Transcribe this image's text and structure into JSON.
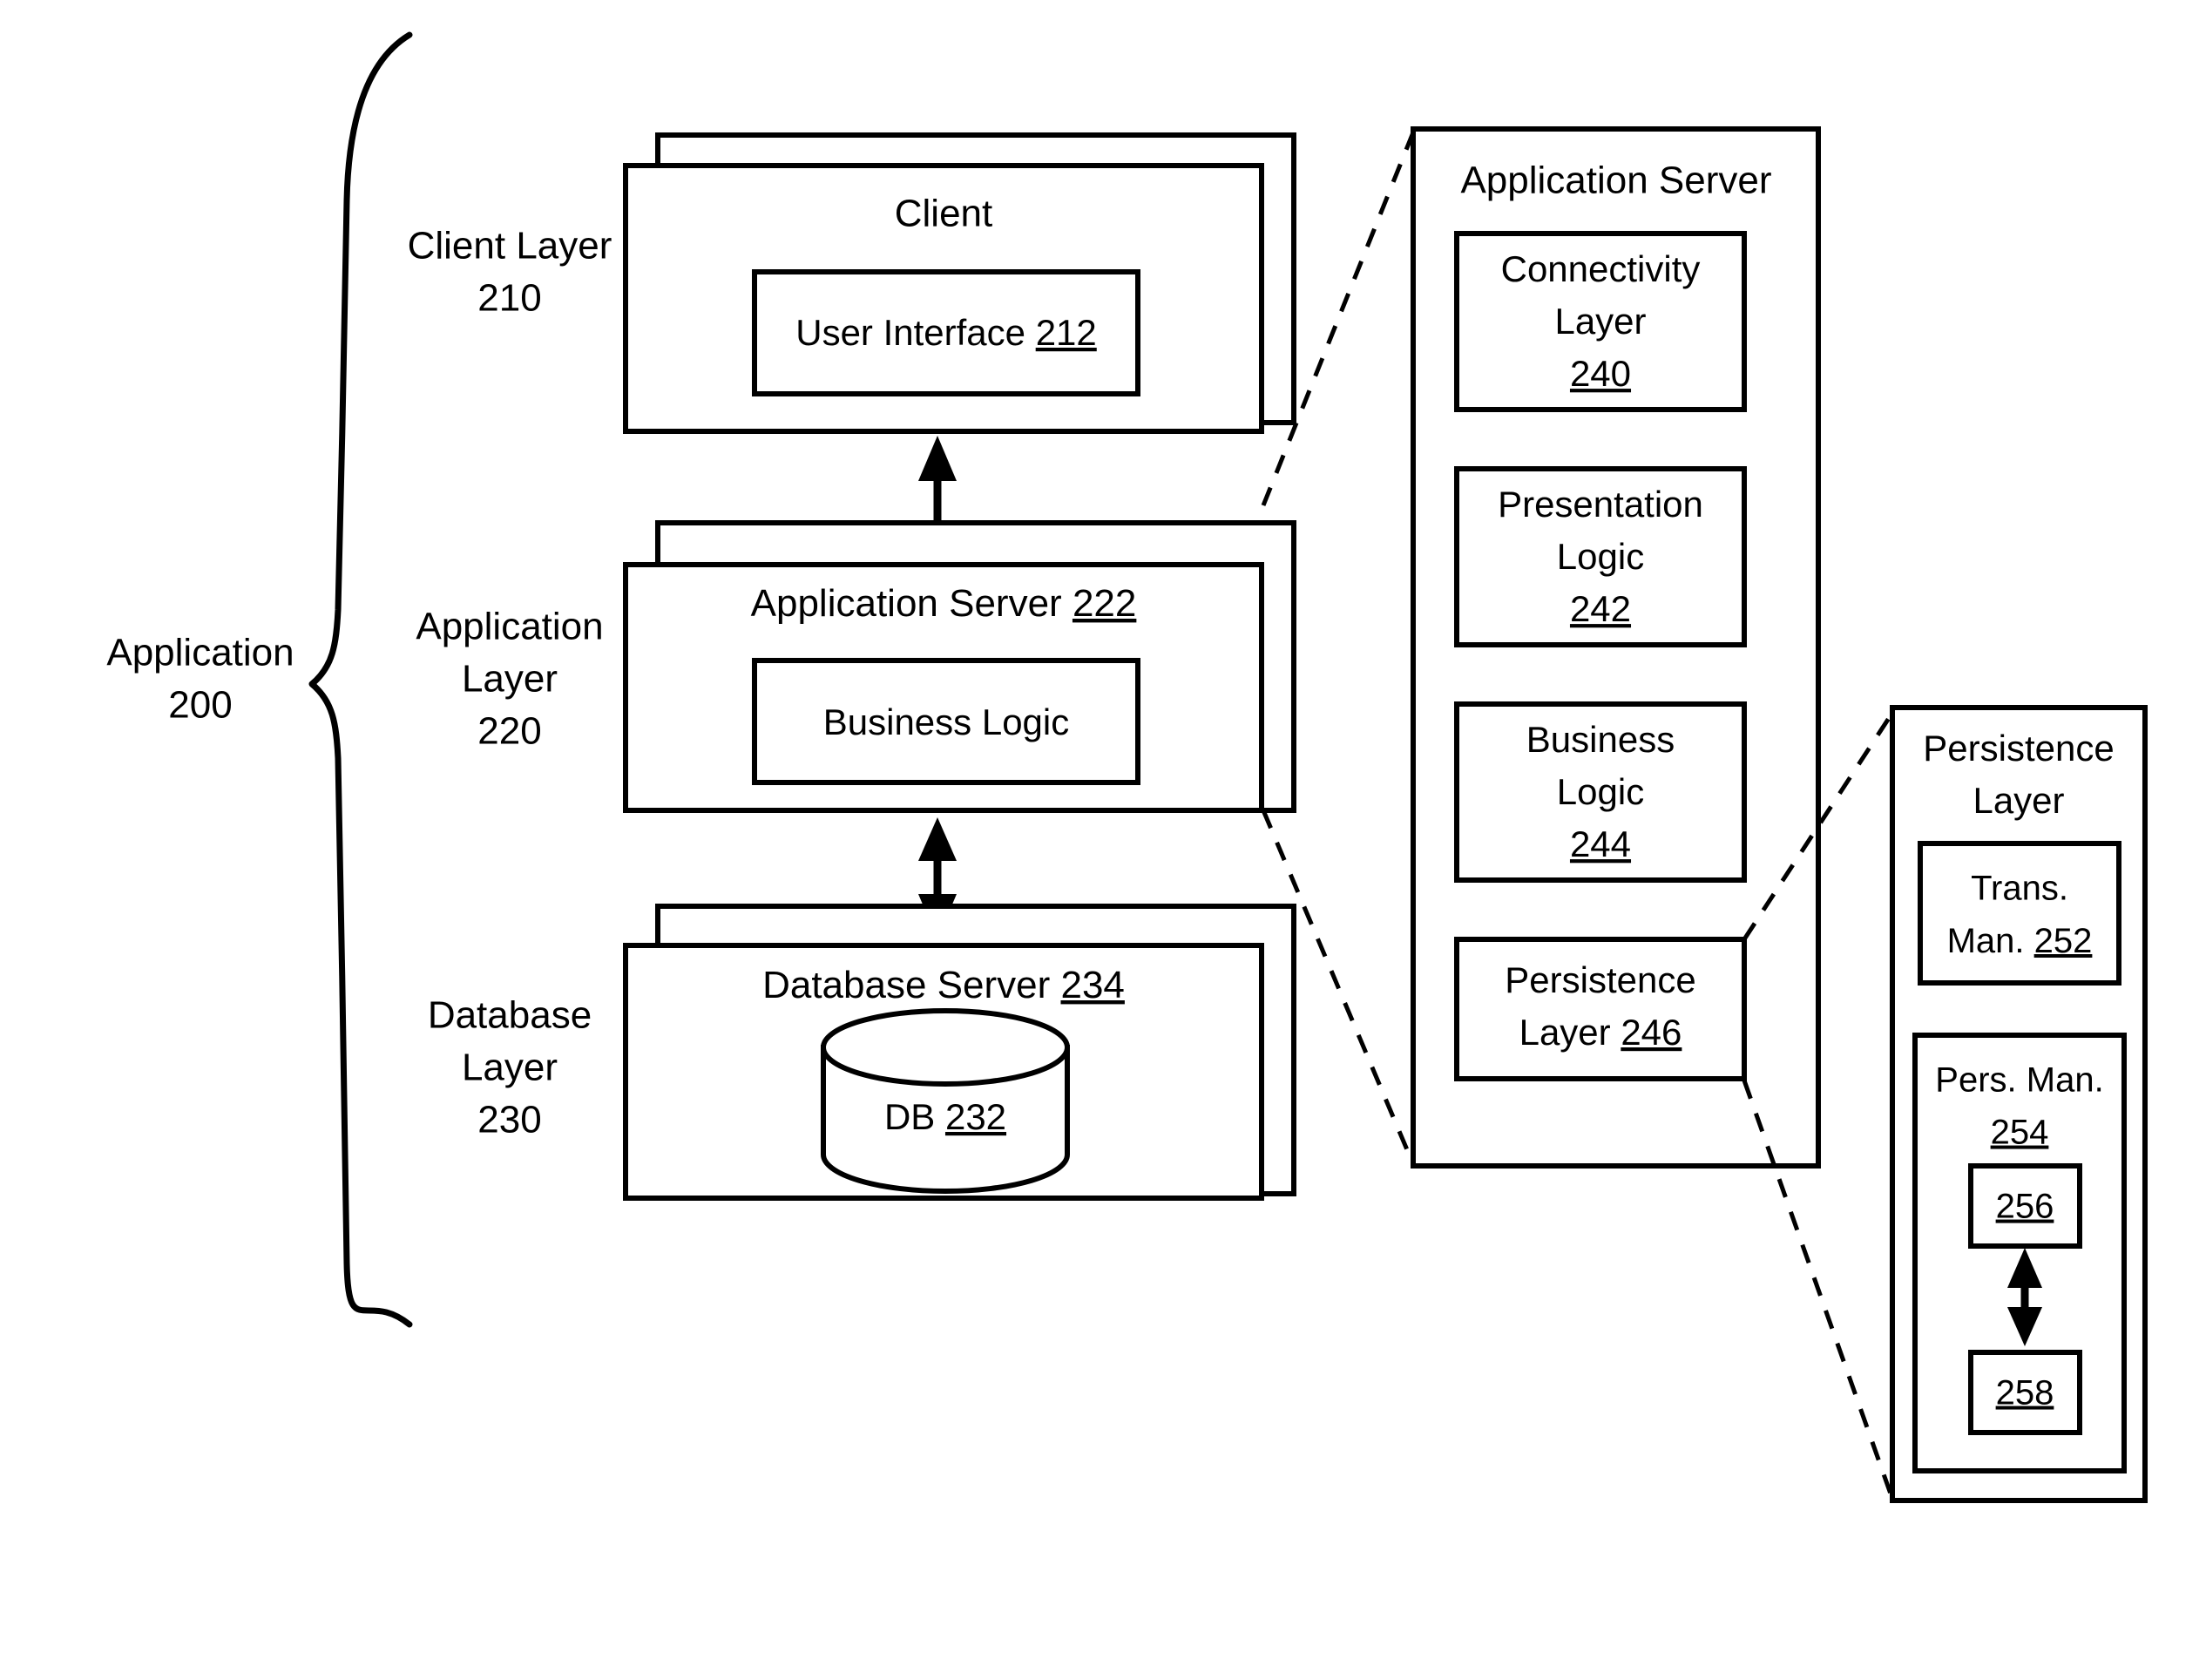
{
  "figure": {
    "type": "architecture-block-diagram",
    "background": "#ffffff",
    "line_color": "#000000"
  },
  "brace": {
    "label_line1": "Application",
    "label_line2": "200"
  },
  "layers": [
    {
      "name": "client-layer",
      "label_line1": "Client Layer",
      "label_line2": "210",
      "ref": "210"
    },
    {
      "name": "application-layer",
      "label_line1": "Application",
      "label_line2": "Layer",
      "label_line3": "220",
      "ref": "220"
    },
    {
      "name": "database-layer",
      "label_line1": "Database",
      "label_line2": "Layer",
      "label_line3": "230",
      "ref": "230"
    }
  ],
  "stacks": {
    "client": {
      "title": "Client",
      "inner_label": "User Interface ",
      "inner_ref": "212"
    },
    "app_server": {
      "title": "Application Server ",
      "title_ref": "222",
      "inner_label": "Business Logic"
    },
    "database": {
      "title": "Database Server ",
      "title_ref": "234",
      "cylinder_label": "DB ",
      "cylinder_ref": "232"
    }
  },
  "app_server_panel": {
    "title": "Application Server",
    "boxes": [
      {
        "line1": "Connectivity",
        "line2": "Layer",
        "ref": "240"
      },
      {
        "line1": "Presentation",
        "line2": "Logic",
        "ref": "242"
      },
      {
        "line1": "Business",
        "line2": "Logic",
        "ref": "244"
      },
      {
        "line1": "Persistence",
        "line2": "Layer ",
        "ref": "246",
        "inline_ref": true
      }
    ]
  },
  "persistence_panel": {
    "title_line1": "Persistence",
    "title_line2": "Layer",
    "trans_man": {
      "line1": "Trans.",
      "line2": "Man. ",
      "ref": "252"
    },
    "pers_man": {
      "line1": "Pers. Man.",
      "ref": "254"
    },
    "nested": [
      {
        "ref": "256"
      },
      {
        "ref": "258"
      }
    ]
  },
  "connectors": {
    "client_to_appserver": "double-arrow-vertical",
    "appserver_to_db": "double-arrow-vertical",
    "nested_256_258": "double-arrow-vertical",
    "callout_top": "dashed-line",
    "callout_bottom": "dashed-line",
    "callout_persistence_top": "dashed-line",
    "callout_persistence_bottom": "dashed-line"
  }
}
